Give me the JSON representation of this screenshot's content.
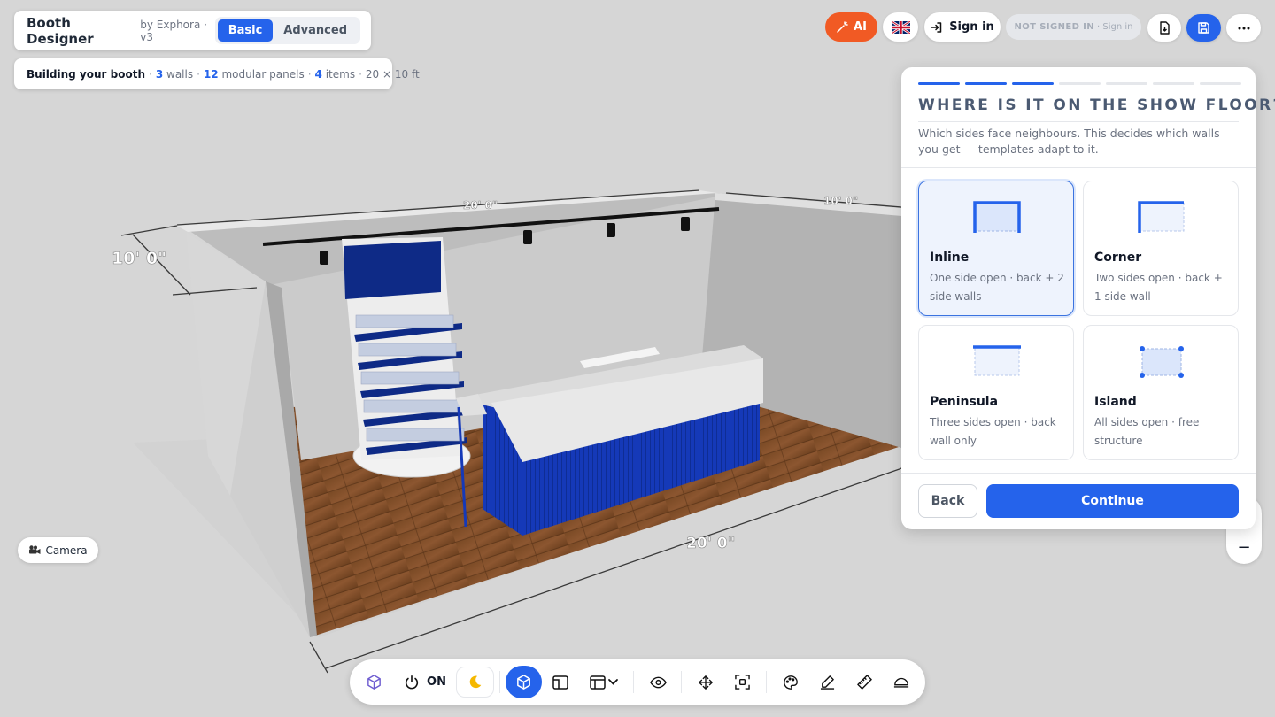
{
  "app": {
    "title": "Booth Designer",
    "subtitle": "by Exphora · v3",
    "modes": [
      {
        "label": "Basic",
        "active": true
      },
      {
        "label": "Advanced",
        "active": false
      }
    ]
  },
  "status": {
    "prefix": "Building your booth",
    "walls_count": "3",
    "walls_label": "walls",
    "panels_count": "12",
    "panels_label": "modular panels",
    "items_count": "4",
    "items_label": "items",
    "size": "20 × 10 ft"
  },
  "topbar": {
    "ai_label": "AI",
    "language_icon": "uk-flag-icon",
    "signin_label": "Sign in",
    "not_signed_label": "NOT SIGNED IN",
    "not_signed_small": "· Sign in",
    "accent": "#2563eb",
    "ai_color": "#f15a24"
  },
  "scene": {
    "dim_height": "10' 0\"",
    "dim_back_width": "20' 0\"",
    "dim_side_depth": "10' 0\"",
    "dim_front_width": "20' 0\""
  },
  "wizard": {
    "step_current": 3,
    "step_total": 7,
    "title": "WHERE IS IT ON THE SHOW FLOOR?",
    "description": "Which sides face neighbours. This decides which walls you get — templates adapt to it.",
    "options": [
      {
        "name": "Inline",
        "desc": "One side open · back + 2 side walls",
        "selected": true
      },
      {
        "name": "Corner",
        "desc": "Two sides open · back + 1 side wall",
        "selected": false
      },
      {
        "name": "Peninsula",
        "desc": "Three sides open · back wall only",
        "selected": false
      },
      {
        "name": "Island",
        "desc": "All sides open · free structure",
        "selected": false
      }
    ],
    "back_label": "Back",
    "continue_label": "Continue"
  },
  "camera": {
    "label": "Camera",
    "icon": "video-camera-icon"
  },
  "zoom": {
    "minus_label": "−"
  },
  "toolbar": {
    "power_label": "ON",
    "icons": [
      "cube-outline-icon",
      "power-icon",
      "moon-icon",
      "3d-view-icon",
      "2d-view-icon",
      "layout-dropdown-icon",
      "eye-icon",
      "move-icon",
      "focus-icon",
      "palette-icon",
      "pen-icon",
      "ruler-icon",
      "dome-light-icon"
    ]
  }
}
